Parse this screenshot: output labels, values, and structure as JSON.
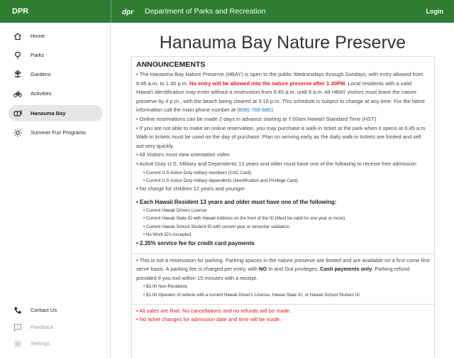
{
  "brand": "DPR",
  "header": {
    "title": "Department of Parks and Recreation",
    "login_label": "Login"
  },
  "sidebar": {
    "items": [
      {
        "label": "Home"
      },
      {
        "label": "Parks"
      },
      {
        "label": "Gardens"
      },
      {
        "label": "Activities"
      },
      {
        "label": "Hanauma Bay"
      },
      {
        "label": "Summer Fun Programs"
      }
    ],
    "bottom": [
      {
        "label": "Contact Us"
      },
      {
        "label": "Feedback"
      },
      {
        "label": "Settings"
      }
    ]
  },
  "page": {
    "title": "Hanauma Bay Nature Preserve",
    "announcements_heading": "ANNOUNCEMENTS",
    "a1_pre": "• The Hanauma Bay Nature Preserve (HBAY) is open to the public Wednesdays through Sundays, with entry allowed from 6:45 a.m. to 1:30 p.m. ",
    "a1_red": "No entry will be allowed into the nature preserve after 1:30PM.",
    "a1_post": " Local residents with a valid Hawai'i identification may enter without a reservation from 6:45 a.m. until 9 a.m. All HBAY visitors must leave the nature preserve by 4 p.m., with the beach being cleared at 3:15 p.m. This schedule is subject to change at any time. For the latest information call the main phone number at ",
    "phone": "(808)-768-6861",
    "a2": "• Online reservations can be made 2 days in advance starting at 7:00am Hawai'i Standard Time (HST)",
    "a3": "• If you are not able to make an online reservation, you may purchase a walk-in ticket at the park when it opens at 6:45 a.m. Walk-in tickets must be used on the day of purchase. Plan on arriving early as the daily walk-in tickets are limited and sell out very quickly.",
    "a4": "• All Visitors must view orientation video",
    "a5": "• Active Duty U.S. Military and Dependents 13 years and older must have one of the following to receive free admission",
    "military": [
      "• Current U.S Active Duty military members (CAC Card)",
      "• Current U.S Active Duty military dependents (Identification and Privilege Card)"
    ],
    "a6": "• No charge for children 12 years and younger",
    "resident_heading": "• Each Hawaii Resident 13 years and older must have one of the following:",
    "resident_ids": [
      "• Current Hawaii Drivers License",
      "• Current Hawaii State ID with Hawaii Address on the front of the ID (Must be valid for one year or more)",
      "• Current Hawaii School Student ID with current year or semester validation",
      "• No Work ID's Accepted"
    ],
    "fee": "• 2.35% service fee for credit card payments",
    "parking_pre": "• This is not a reservation for parking. Parking spaces in the nature preserve are limited and are available on a first come first serve basis. A parking fee is charged per entry, with ",
    "parking_no": "NO",
    "parking_mid": " In and Out privileges. ",
    "parking_cash": "Cash payments only",
    "parking_post": ". Parking refund provided if you exit within 15 minutes with a receipt.",
    "parking_rates": [
      "• $3.00 Non-Residents",
      "• $1.00 Operator of vehicle with a current Hawaii Driver's License, Hawaii State ID, or Hawaii School Student ID"
    ],
    "sales_final": "• All sales are final. No cancellations and no refunds will be made.",
    "no_changes": "• No ticket changes for admission date and time will be made."
  },
  "colors": {
    "header_bg": "#2e7d32",
    "alert_red": "#e11b1b",
    "link_blue": "#1e73c8"
  }
}
